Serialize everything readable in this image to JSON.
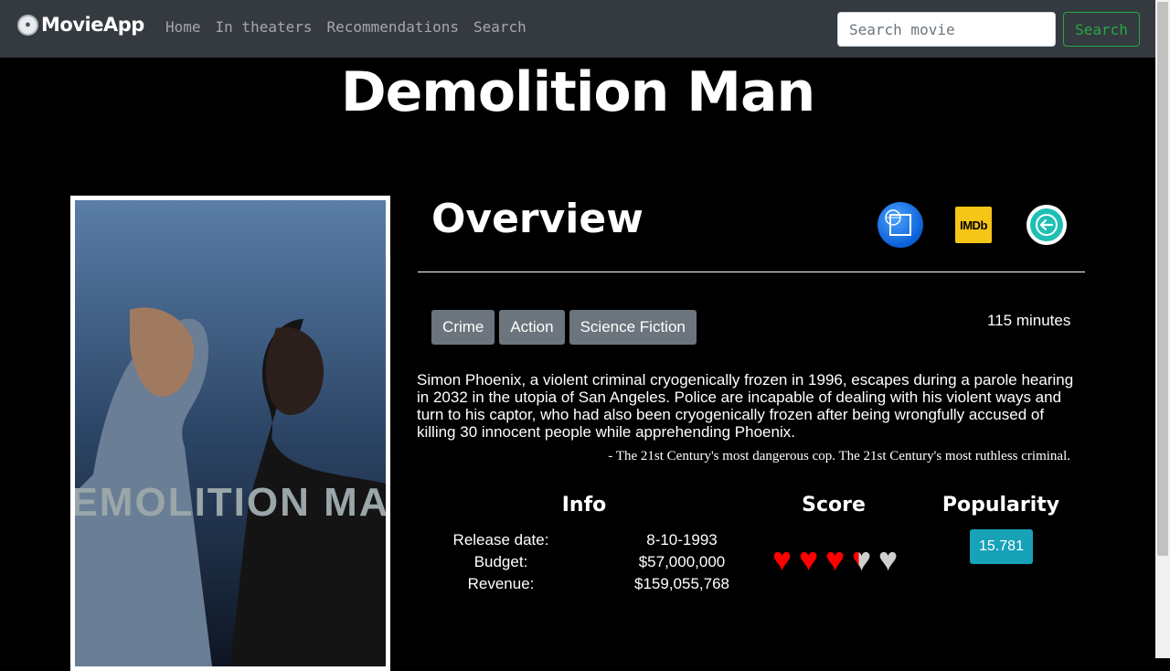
{
  "navbar": {
    "brand": "MovieApp",
    "links": [
      "Home",
      "In theaters",
      "Recommendations",
      "Search"
    ],
    "search_placeholder": "Search movie",
    "search_button": "Search"
  },
  "movie": {
    "title": "Demolition Man",
    "poster_title": "DEMOLITION MAN",
    "overview_heading": "Overview",
    "genres": [
      "Crime",
      "Action",
      "Science Fiction"
    ],
    "runtime": "115 minutes",
    "description": "Simon Phoenix, a violent criminal cryogenically frozen in 1996, escapes during a parole hearing in 2032 in the utopia of San Angeles. Police are incapable of dealing with his violent ways and turn to his captor, who had also been cryogenically frozen after being wrongfully accused of killing 30 innocent people while apprehending Phoenix.",
    "tagline": "- The 21st Century's most dangerous cop. The 21st Century's most ruthless criminal.",
    "info_heading": "Info",
    "info": [
      {
        "label": "Release date:",
        "value": "8-10-1993"
      },
      {
        "label": "Budget:",
        "value": "$57,000,000"
      },
      {
        "label": "Revenue:",
        "value": "$159,055,768"
      }
    ],
    "score_heading": "Score",
    "score_hearts": 3.4,
    "score_max": 5,
    "popularity_heading": "Popularity",
    "popularity": "15.781"
  },
  "icons": {
    "imdb_label": "IMDb"
  },
  "colors": {
    "navbar_bg": "#343a40",
    "search_button": "#28a745",
    "genre_badge": "#6c757d",
    "popularity_badge": "#17a2b8",
    "heart_full": "#ff0000",
    "heart_empty": "#cfcfcf"
  }
}
